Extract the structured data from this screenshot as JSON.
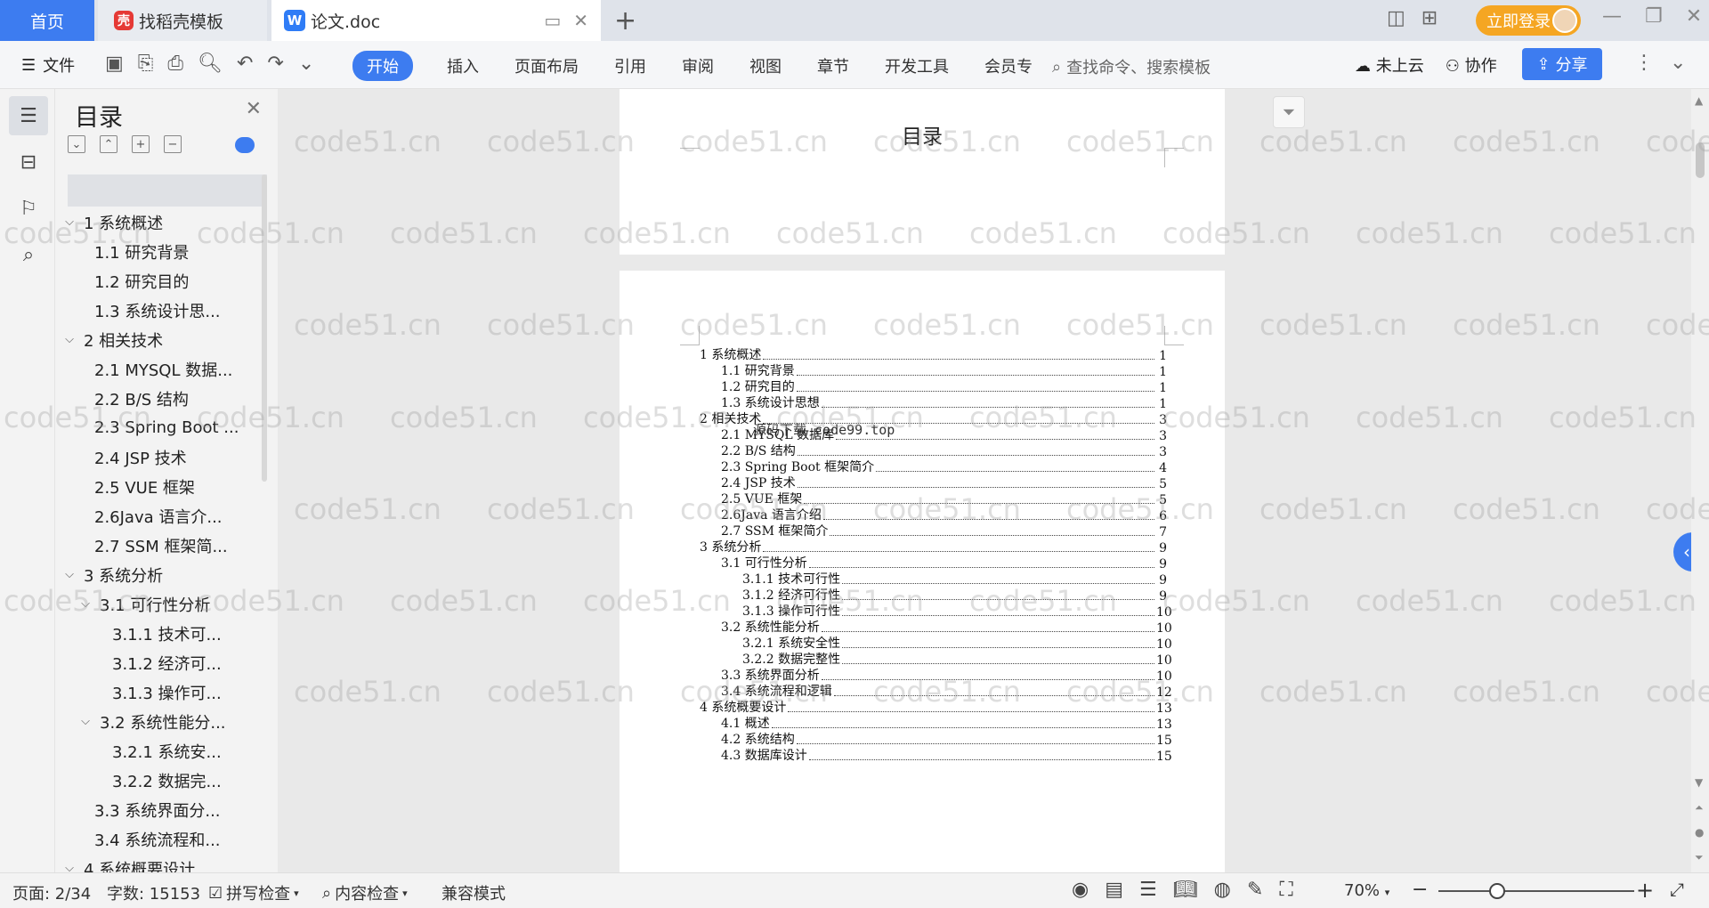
{
  "titlebar": {
    "home_tab": "首页",
    "template_tab": "找稻壳模板",
    "doc_tab": "论文.doc",
    "login_label": "立即登录"
  },
  "menubar": {
    "file_label": "文件",
    "tabs": [
      "开始",
      "插入",
      "页面布局",
      "引用",
      "审阅",
      "视图",
      "章节",
      "开发工具",
      "会员专"
    ],
    "search_placeholder": "查找命令、搜索模板",
    "cloud_label": "未上云",
    "collab_label": "协作",
    "share_label": "分享"
  },
  "outline": {
    "title": "目录",
    "items": [
      {
        "label": "1 系统概述",
        "level": 1,
        "expanded": true
      },
      {
        "label": "1.1  研究背景",
        "level": 2
      },
      {
        "label": "1.2 研究目的",
        "level": 2
      },
      {
        "label": "1.3 系统设计思...",
        "level": 2
      },
      {
        "label": "2 相关技术",
        "level": 1,
        "expanded": true
      },
      {
        "label": "2.1 MYSQL 数据...",
        "level": 2
      },
      {
        "label": "2.2 B/S 结构",
        "level": 2
      },
      {
        "label": "2.3 Spring Boot ...",
        "level": 2
      },
      {
        "label": "2.4 JSP 技术",
        "level": 2
      },
      {
        "label": "2.5 VUE 框架",
        "level": 2
      },
      {
        "label": "2.6Java 语言介...",
        "level": 2
      },
      {
        "label": "2.7 SSM 框架简...",
        "level": 2
      },
      {
        "label": "3 系统分析",
        "level": 1,
        "expanded": true
      },
      {
        "label": "3.1 可行性分析",
        "level": 2,
        "expanded": true
      },
      {
        "label": "3.1.1 技术可...",
        "level": 3
      },
      {
        "label": "3.1.2 经济可...",
        "level": 3
      },
      {
        "label": "3.1.3 操作可...",
        "level": 3
      },
      {
        "label": "3.2 系统性能分...",
        "level": 2,
        "expanded": true
      },
      {
        "label": "3.2.1  系统安...",
        "level": 3
      },
      {
        "label": "3.2.2  数据完...",
        "level": 3
      },
      {
        "label": "3.3 系统界面分...",
        "level": 2
      },
      {
        "label": "3.4 系统流程和...",
        "level": 2
      },
      {
        "label": "4 系统概要设计",
        "level": 1,
        "expanded": true
      }
    ]
  },
  "document": {
    "page1_heading": "目录",
    "overlay_text": "源码下载 code99.top",
    "toc": [
      {
        "title": "1 系统概述",
        "page": "1",
        "level": 1
      },
      {
        "title": "1.1  研究背景",
        "page": "1",
        "level": 2
      },
      {
        "title": "1.2 研究目的",
        "page": "1",
        "level": 2
      },
      {
        "title": "1.3 系统设计思想",
        "page": "1",
        "level": 2
      },
      {
        "title": "2 相关技术",
        "page": "3",
        "level": 1
      },
      {
        "title": "2.1 MYSQL 数据库",
        "page": "3",
        "level": 2
      },
      {
        "title": "2.2 B/S 结构",
        "page": "3",
        "level": 2
      },
      {
        "title": "2.3 Spring Boot 框架简介",
        "page": "4",
        "level": 2
      },
      {
        "title": "2.4 JSP 技术",
        "page": "5",
        "level": 2
      },
      {
        "title": "2.5 VUE 框架",
        "page": "5",
        "level": 2
      },
      {
        "title": "2.6Java 语言介绍",
        "page": "6",
        "level": 2
      },
      {
        "title": "2.7 SSM 框架简介",
        "page": "7",
        "level": 2
      },
      {
        "title": "3 系统分析",
        "page": "9",
        "level": 1
      },
      {
        "title": "3.1 可行性分析",
        "page": "9",
        "level": 2
      },
      {
        "title": "3.1.1 技术可行性",
        "page": "9",
        "level": 3
      },
      {
        "title": "3.1.2 经济可行性",
        "page": "9",
        "level": 3
      },
      {
        "title": "3.1.3 操作可行性",
        "page": "10",
        "level": 3
      },
      {
        "title": "3.2 系统性能分析",
        "page": "10",
        "level": 2
      },
      {
        "title": "3.2.1  系统安全性",
        "page": "10",
        "level": 3
      },
      {
        "title": "3.2.2  数据完整性",
        "page": "10",
        "level": 3
      },
      {
        "title": "3.3 系统界面分析",
        "page": "10",
        "level": 2
      },
      {
        "title": "3.4 系统流程和逻辑",
        "page": "12",
        "level": 2
      },
      {
        "title": "4 系统概要设计",
        "page": "13",
        "level": 1
      },
      {
        "title": "4.1 概述",
        "page": "13",
        "level": 2
      },
      {
        "title": "4.2 系统结构",
        "page": "15",
        "level": 2
      },
      {
        "title": "4.3 数据库设计",
        "page": "15",
        "level": 2
      }
    ]
  },
  "watermark": "code51.cn",
  "statusbar": {
    "page": "页面: 2/34",
    "wordcount": "字数: 15153",
    "spellcheck": "拼写检查",
    "contentcheck": "内容检查",
    "compat": "兼容模式",
    "zoom": "70%"
  },
  "colors": {
    "accent": "#3d7cf0",
    "login": "#f5a623"
  }
}
